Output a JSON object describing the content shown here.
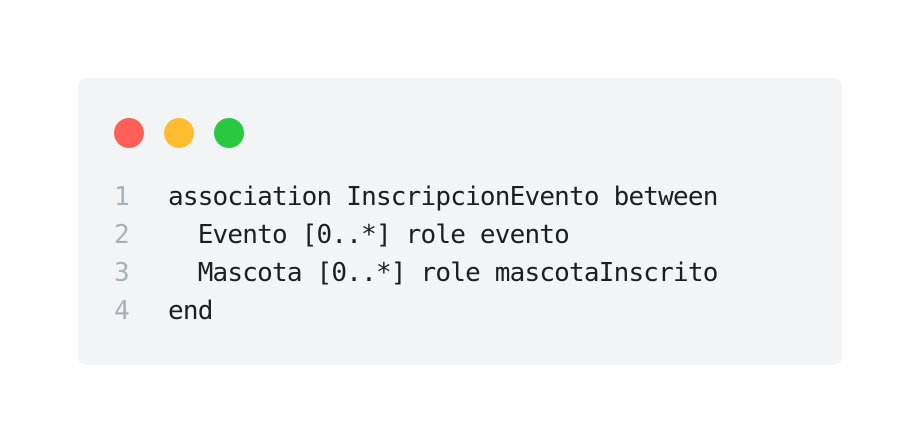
{
  "window": {
    "controls": [
      {
        "name": "close",
        "color": "#ff5f57"
      },
      {
        "name": "minimize",
        "color": "#febc2e"
      },
      {
        "name": "maximize",
        "color": "#28c840"
      }
    ]
  },
  "code": {
    "lines": [
      {
        "number": "1",
        "text": "association InscripcionEvento between"
      },
      {
        "number": "2",
        "text": "  Evento [0..*] role evento"
      },
      {
        "number": "3",
        "text": "  Mascota [0..*] role mascotaInscrito"
      },
      {
        "number": "4",
        "text": "end"
      }
    ]
  }
}
